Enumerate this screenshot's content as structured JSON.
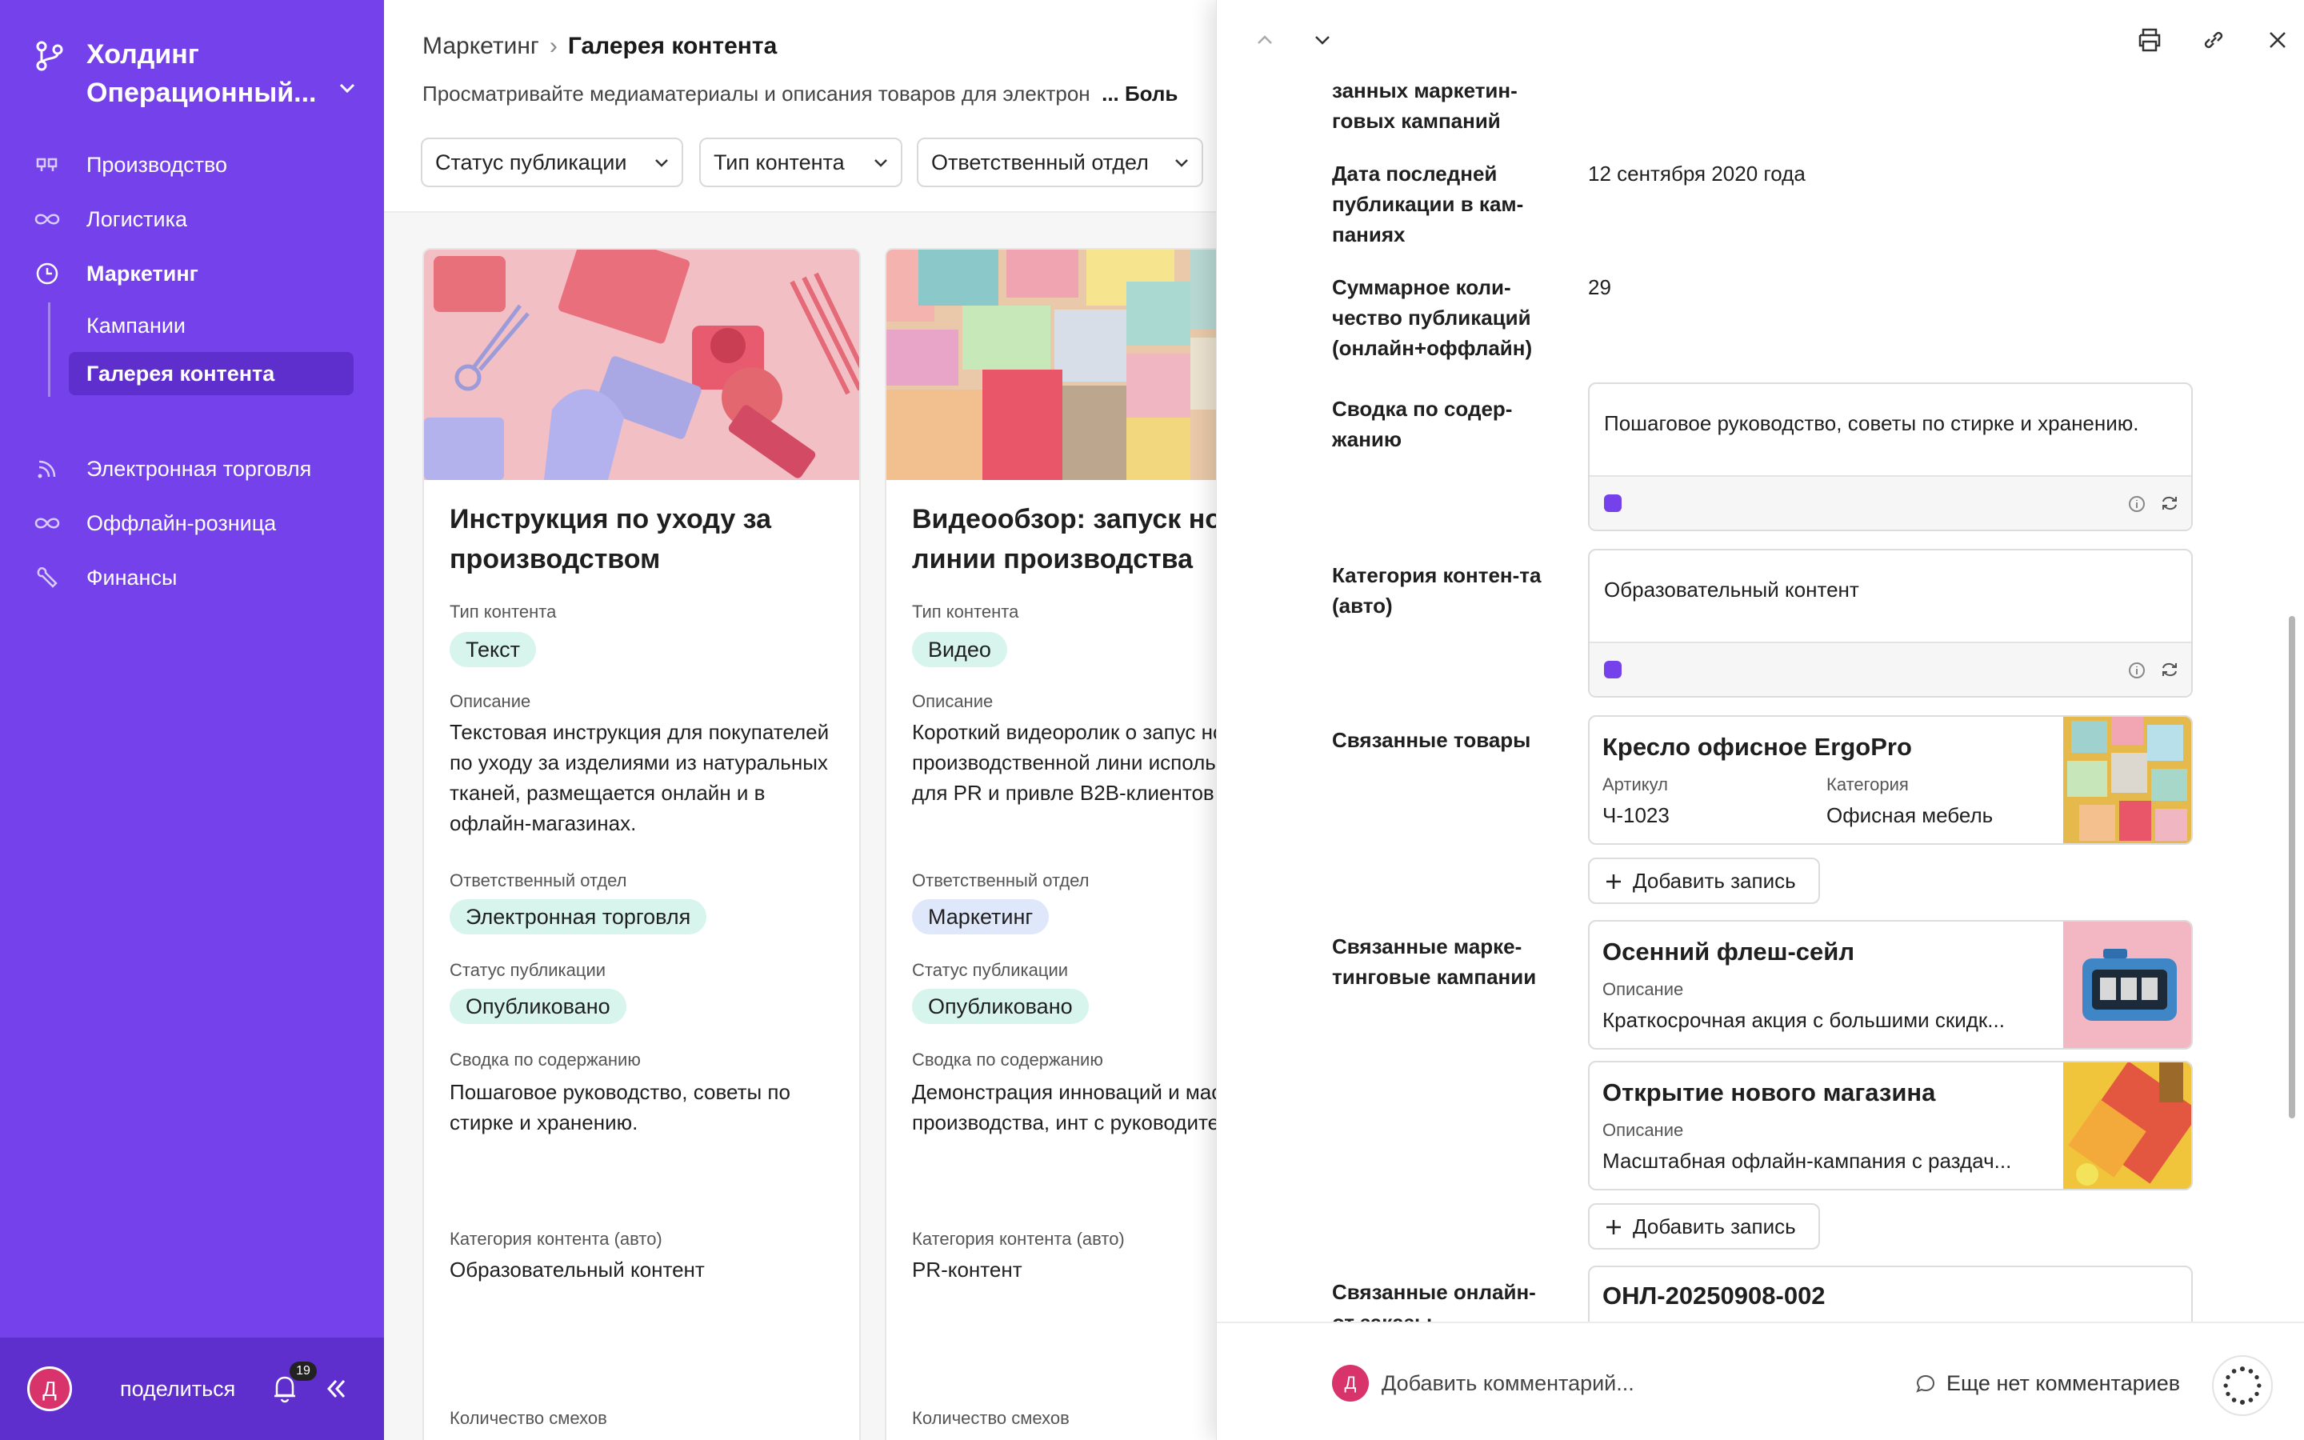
{
  "sidebar": {
    "workspace_name": "Холдинг Операционный...",
    "nav": [
      {
        "label": "Производство",
        "icon": "quote-icon"
      },
      {
        "label": "Логистика",
        "icon": "infinity-icon"
      },
      {
        "label": "Маркетинг",
        "icon": "clock-icon"
      },
      {
        "label": "Электронная торговля",
        "icon": "rss-icon"
      },
      {
        "label": "Оффлайн-розница",
        "icon": "infinity-icon"
      },
      {
        "label": "Финансы",
        "icon": "wrench-icon"
      }
    ],
    "sub": [
      {
        "label": "Кампании"
      },
      {
        "label": "Галерея контента"
      }
    ],
    "avatar_initial": "Д",
    "share_label": "поделиться",
    "notif_count": "19"
  },
  "main": {
    "breadcrumb_parent": "Маркетинг",
    "breadcrumb_current": "Галерея контента",
    "description": "Просматривайте медиаматериалы и описания товаров для электрон",
    "description_more": "... Боль",
    "filters": [
      "Статус публикации",
      "Тип контента",
      "Ответственный отдел"
    ],
    "labels": {
      "type": "Тип контента",
      "description": "Описание",
      "department": "Ответственный отдел",
      "status": "Статус публикации",
      "summary": "Сводка по содержанию",
      "category": "Категория контента (авто)",
      "laughs": "Количество смехов"
    },
    "cards": [
      {
        "title": "Инструкция по уходу за производством",
        "type": "Текст",
        "description": "Текстовая инструкция для покупателей по уходу за изделиями из натуральных тканей, размещается онлайн и в офлайн-магазинах.",
        "department": "Электронная торговля",
        "status": "Опубликовано",
        "summary": "Пошаговое руководство, советы по стирке и хранению.",
        "category": "Образовательный контент"
      },
      {
        "title": "Видеообзор: запуск но линии производства",
        "type": "Видео",
        "description": "Короткий видеоролик о запус новой производственной лини используется для PR и привле B2B-клиентов.",
        "department": "Маркетинг",
        "status": "Опубликовано",
        "summary": "Демонстрация инноваций и масштабов производства, инт с руководителями.",
        "category": "PR-контент"
      }
    ]
  },
  "panel": {
    "top_label_partial": "занных маркетин-\nговых кампаний",
    "fields": {
      "last_pub_label": "Дата последней публикации в кам-паниях",
      "last_pub_value": "12 сентября 2020 года",
      "total_label": "Суммарное коли-чество публикаций (онлайн+оффлайн)",
      "total_value": "29",
      "summary_label": "Сводка по содер-жанию",
      "summary_value": "Пошаговое руководство, советы по стирке и хранению.",
      "category_label": "Категория контен-та (авто)",
      "category_value": "Образовательный контент",
      "products_label": "Связанные товары",
      "campaigns_label": "Связанные марке-тинговые кампании",
      "orders_label": "Связанные онлайн-от заказы"
    },
    "product": {
      "title": "Кресло офисное ErgoPro",
      "sku_label": "Артикул",
      "sku": "Ч-1023",
      "cat_label": "Категория",
      "cat": "Офисная мебель"
    },
    "campaigns": [
      {
        "title": "Осенний флеш-сейл",
        "desc_label": "Описание",
        "desc": "Краткосрочная акция с большими скидк..."
      },
      {
        "title": "Открытие нового магазина",
        "desc_label": "Описание",
        "desc": "Масштабная офлайн-кампания с раздач..."
      }
    ],
    "add_record_label": "Добавить запись",
    "order_title": "ОНЛ-20250908-002",
    "footer": {
      "avatar_initial": "Д",
      "add_comment": "Добавить комментарий...",
      "no_comments": "Еще нет комментариев"
    }
  },
  "colors": {
    "sidebar": "#7541ea",
    "pill_green": "#d7f5ec",
    "pill_blue": "#dfe7fb"
  }
}
